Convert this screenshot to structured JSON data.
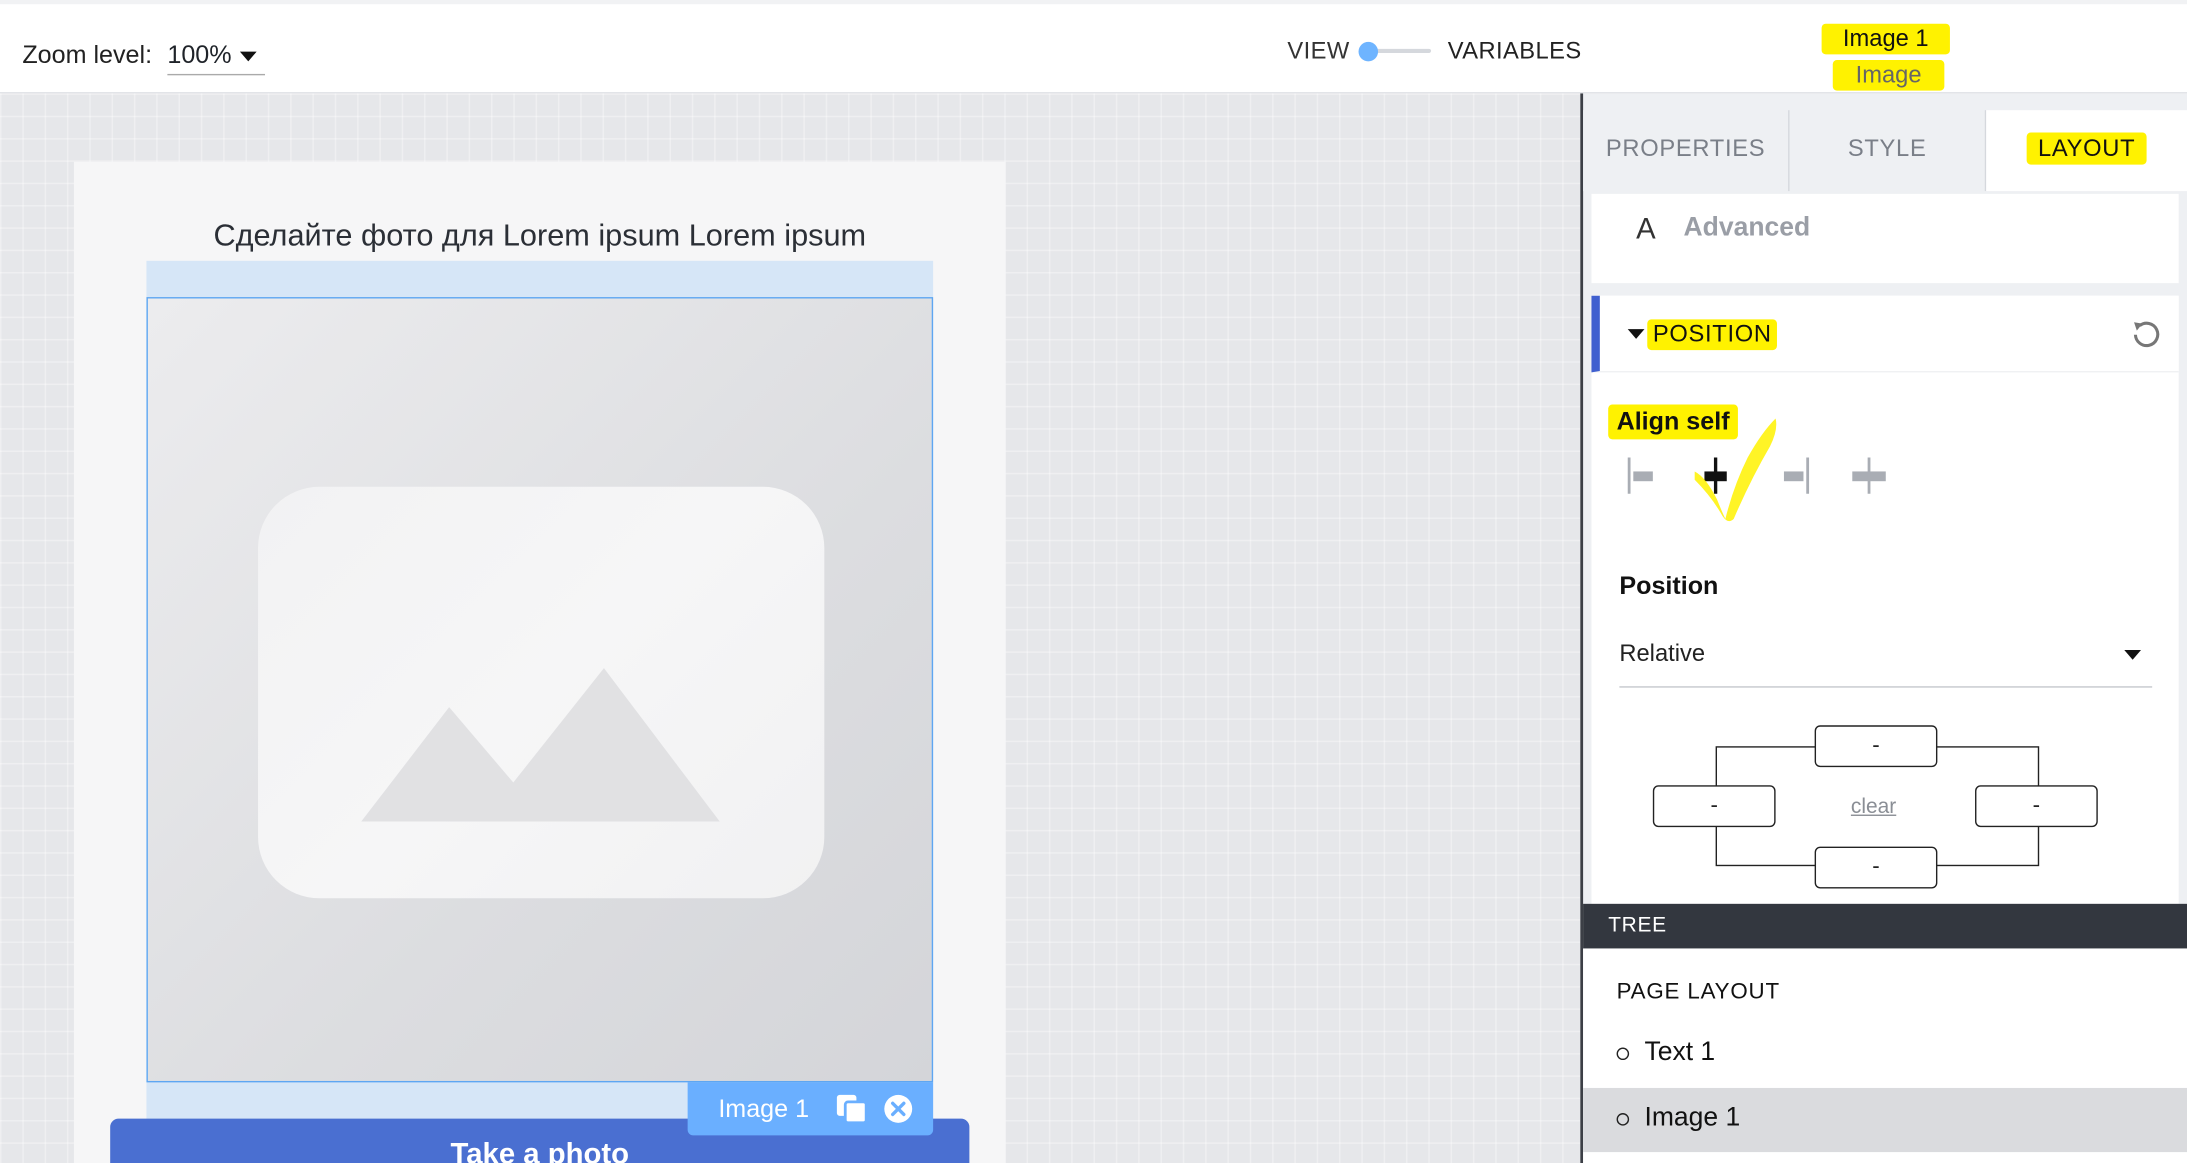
{
  "topbar": {
    "zoom_label": "Zoom level:",
    "zoom_value": "100%",
    "view_label": "VIEW",
    "variables_label": "VARIABLES",
    "selected_title": "Image 1",
    "selected_type": "Image"
  },
  "canvas": {
    "screen_text": "Сделайте фото для Lorem ipsum Lorem ipsum",
    "image_tag_label": "Image 1",
    "cta_label": "Take a photo"
  },
  "panel": {
    "tabs": [
      {
        "label": "PROPERTIES",
        "active": false
      },
      {
        "label": "STYLE",
        "active": false
      },
      {
        "label": "LAYOUT",
        "active": true
      }
    ],
    "advanced": {
      "icon_letter": "A",
      "label": "Advanced"
    },
    "position_section": {
      "title": "POSITION",
      "align_self_label": "Align self",
      "align_options": [
        "flex-start",
        "center",
        "flex-end",
        "stretch"
      ],
      "align_selected": "center",
      "position_label": "Position",
      "position_value": "Relative",
      "box": {
        "top": "-",
        "left": "-",
        "right": "-",
        "bottom": "-",
        "clear_label": "clear"
      }
    },
    "tree": {
      "bar_label": "TREE",
      "section_title": "PAGE LAYOUT",
      "items": [
        {
          "label": "Text 1",
          "selected": false
        },
        {
          "label": "Image 1",
          "selected": true
        }
      ]
    }
  },
  "colors": {
    "accent": "#4a6fd1",
    "selection": "#6aafff",
    "highlight": "#fff200",
    "panel_bar": "#33373f"
  }
}
